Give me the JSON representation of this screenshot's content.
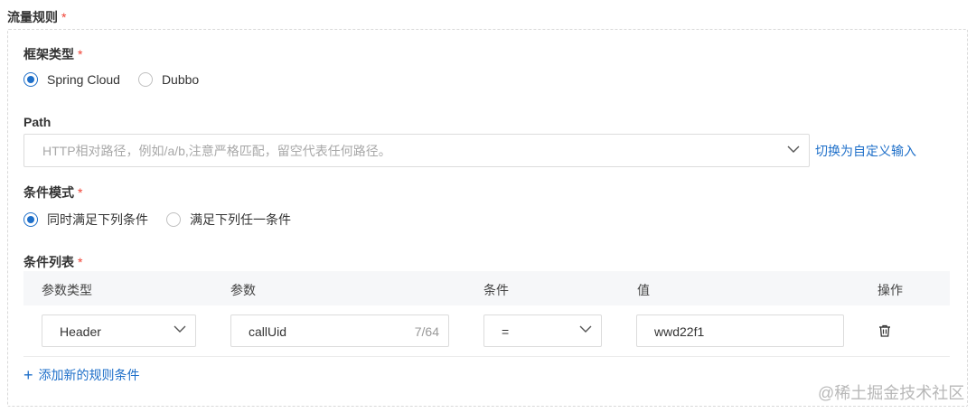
{
  "section": {
    "title": "流量规则",
    "required_mark": "*"
  },
  "framework": {
    "label": "框架类型",
    "required_mark": "*",
    "options": [
      {
        "label": "Spring Cloud",
        "checked": true
      },
      {
        "label": "Dubbo",
        "checked": false
      }
    ]
  },
  "path": {
    "label": "Path",
    "placeholder": "HTTP相对路径，例如/a/b,注意严格匹配，留空代表任何路径。",
    "switch_link": "切换为自定义输入"
  },
  "condition_mode": {
    "label": "条件模式",
    "required_mark": "*",
    "options": [
      {
        "label": "同时满足下列条件",
        "checked": true
      },
      {
        "label": "满足下列任一条件",
        "checked": false
      }
    ]
  },
  "condition_list": {
    "label": "条件列表",
    "required_mark": "*",
    "columns": [
      "参数类型",
      "参数",
      "条件",
      "值",
      "操作"
    ],
    "rows": [
      {
        "param_type": "Header",
        "param": "callUid",
        "param_counter": "7/64",
        "condition": "=",
        "value": "wwd22f1"
      }
    ],
    "add_label": "添加新的规则条件"
  },
  "watermark": "@稀土掘金技术社区",
  "icons": {
    "chevron": "chevron-down-icon",
    "delete": "trash-icon",
    "add": "plus-icon"
  },
  "colors": {
    "accent": "#1e6fc9",
    "required": "#f04134"
  }
}
